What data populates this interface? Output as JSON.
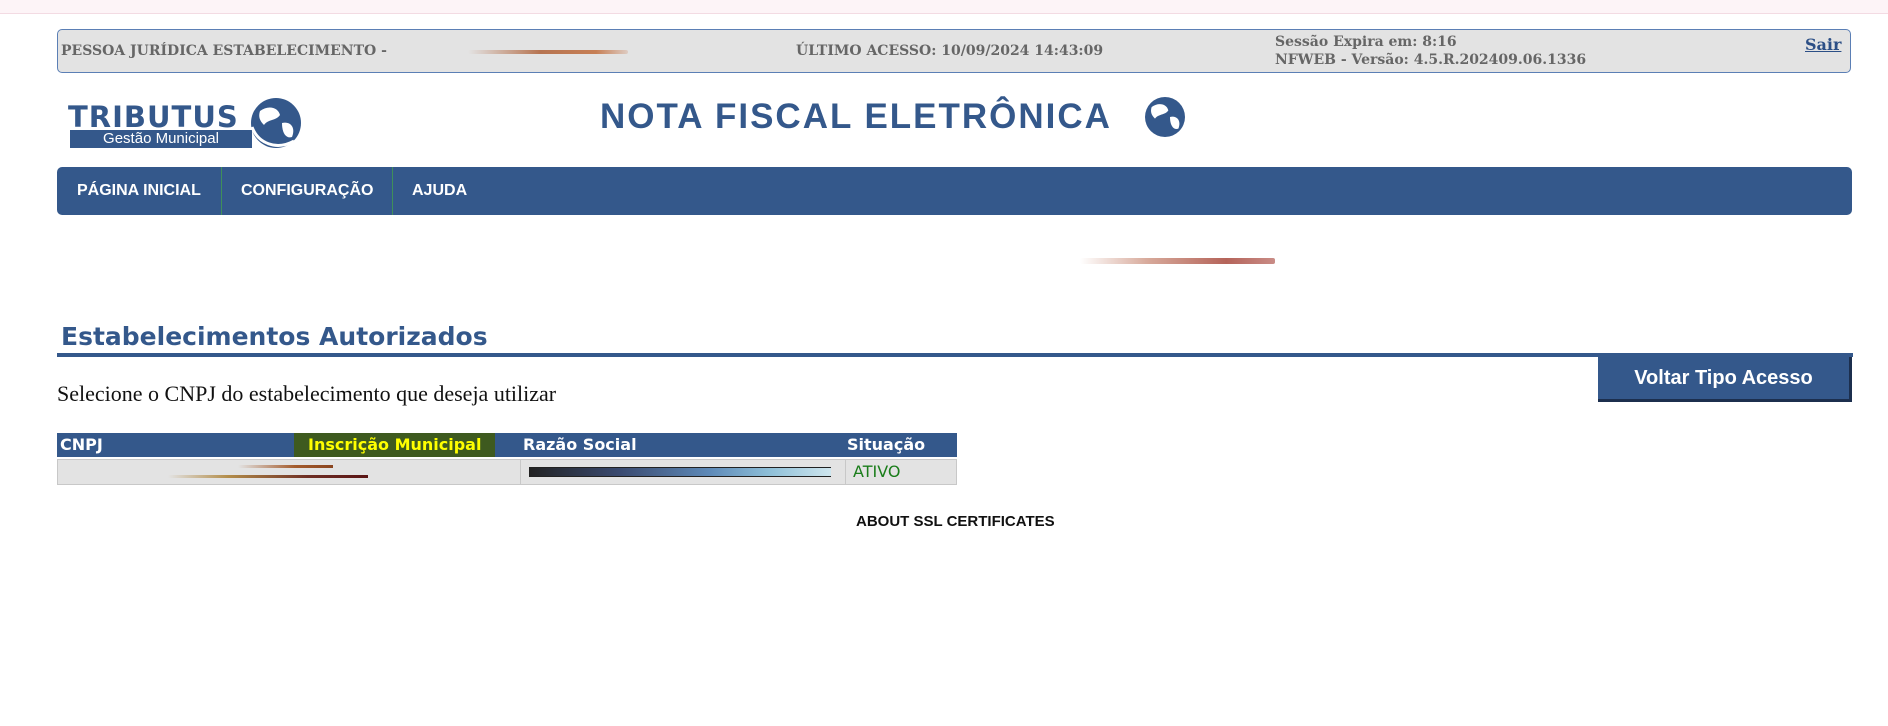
{
  "info_bar": {
    "pessoa_label": "PESSOA JURÍDICA ESTABELECIMENTO -",
    "ultimo_acesso": "ÚLTIMO ACESSO: 10/09/2024 14:43:09",
    "sessao": "Sessão Expira em: 8:16",
    "versao": "NFWEB -  Versão: 4.5.R.202409.06.1336",
    "sair": "Sair"
  },
  "logos": {
    "tributus": "TRIBUTUS",
    "tributus_sub": "Gestão Municipal",
    "nfe": "NOTA FISCAL ELETRÔNICA"
  },
  "nav": {
    "items": [
      "PÁGINA INICIAL",
      "CONFIGURAÇÃO",
      "AJUDA"
    ]
  },
  "page": {
    "title": "Estabelecimentos Autorizados",
    "voltar_button": "Voltar Tipo Acesso",
    "instructions": "Selecione o CNPJ do estabelecimento que deseja utilizar"
  },
  "table": {
    "columns": [
      "CNPJ",
      "Inscrição Municipal",
      "Razão Social",
      "Situação"
    ],
    "rows": [
      {
        "situacao": "ATIVO"
      }
    ]
  },
  "footer": {
    "ssl": "ABOUT SSL CERTIFICATES"
  },
  "colors": {
    "brand_blue": "#34588b",
    "status_green": "#1a7d1a",
    "highlight_yellow": "#ffff00"
  }
}
